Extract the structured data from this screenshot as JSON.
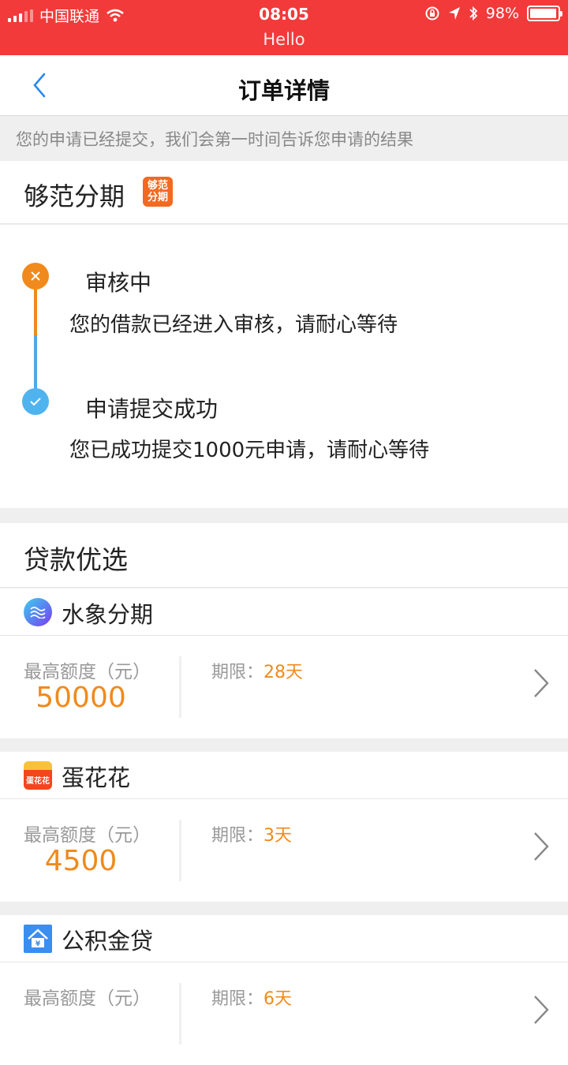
{
  "status_bar": {
    "carrier": "中国联通",
    "time": "08:05",
    "subtitle": "Hello",
    "battery": "98%",
    "battery_level": 0.98,
    "signal_bars_active": 3
  },
  "nav": {
    "title": "订单详情"
  },
  "notice": "您的申请已经提交，我们会第一时间告诉您申请的结果",
  "provider": {
    "name": "够范分期",
    "logo_text": [
      "够范",
      "分期"
    ]
  },
  "timeline": [
    {
      "title": "审核中",
      "desc": "您的借款已经进入审核，请耐心等待",
      "status_color": "#f08a1c",
      "icon": "close-icon"
    },
    {
      "title": "申请提交成功",
      "desc": "您已成功提交1000元申请，请耐心等待",
      "status_color": "#4fb3ee",
      "icon": "check-icon"
    }
  ],
  "section": {
    "title": "贷款优选"
  },
  "loans": [
    {
      "name": "水象分期",
      "limit_label": "最高额度（元）",
      "limit": "50000",
      "term_label": "期限：",
      "term": "28天",
      "icon": "shuixiang-logo-icon",
      "icon_color": "#5a6cf0"
    },
    {
      "name": "蛋花花",
      "limit_label": "最高额度（元）",
      "limit": "4500",
      "term_label": "期限：",
      "term": "3天",
      "icon": "danhuahua-logo-icon",
      "icon_color": "#f25a1e",
      "icon_text": "蛋花花"
    },
    {
      "name": "公积金贷",
      "limit_label": "最高额度（元）",
      "limit": "",
      "term_label": "期限：",
      "term": "6天",
      "icon": "house-logo-icon",
      "icon_color": "#3a8ef0"
    }
  ],
  "colors": {
    "statusbar": "#f23a3a",
    "accent": "#f08a1c",
    "blue": "#4fb3ee"
  }
}
